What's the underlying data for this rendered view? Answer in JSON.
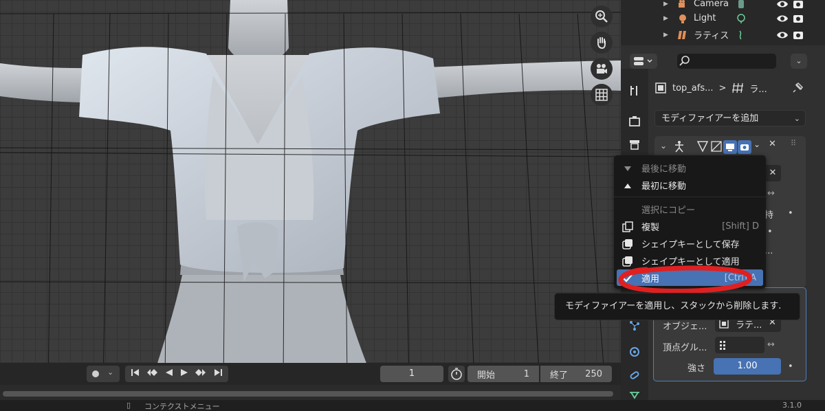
{
  "outliner": {
    "items": [
      {
        "name": "Camera",
        "icon": "camera-object-icon"
      },
      {
        "name": "Light",
        "icon": "light-object-icon"
      },
      {
        "name": "ラティス",
        "icon": "lattice-object-icon"
      }
    ]
  },
  "properties": {
    "search_placeholder": "",
    "breadcrumb": {
      "object": "top_afs...",
      "separator": ">",
      "data": "ラ..."
    },
    "add_modifier_label": "モディファイアーを追加",
    "modifier2": {
      "object_label": "オブジェ...",
      "object_value": "ラテ...",
      "vertex_group_label": "頂点グル...",
      "strength_label": "強さ",
      "strength_value": "1.00"
    },
    "partial_labels": {
      "keep": "持",
      "dot1": "•",
      "dot2": "•",
      "dot3": "..."
    }
  },
  "context_menu": {
    "items": [
      {
        "label": "最後に移動",
        "shortcut": "",
        "icon": "triangle-down-icon",
        "state": "disabled"
      },
      {
        "label": "最初に移動",
        "shortcut": "",
        "icon": "triangle-up-icon",
        "state": "normal"
      },
      {
        "label": "選択にコピー",
        "shortcut": "",
        "icon": "",
        "state": "disabled"
      },
      {
        "label": "複製",
        "shortcut": "[Shift] D",
        "icon": "duplicate-icon",
        "state": "normal"
      },
      {
        "label": "シェイプキーとして保存",
        "shortcut": "",
        "icon": "shapekey-icon",
        "state": "normal"
      },
      {
        "label": "シェイプキーとして適用",
        "shortcut": "",
        "icon": "shapekey-icon",
        "state": "normal"
      },
      {
        "label": "適用",
        "shortcut": "[Ctrl] A",
        "icon": "checkmark-icon",
        "state": "active"
      }
    ]
  },
  "tooltip": "モディファイアーを適用し、スタックから削除します.",
  "timeline": {
    "current_frame": "1",
    "start_label": "開始",
    "start_value": "1",
    "end_label": "終了",
    "end_value": "250"
  },
  "statusbar": {
    "context_menu": "コンテクストメニュー",
    "version": "3.1.0"
  },
  "colors": {
    "accent": "#4772b3",
    "annotation": "#e02020"
  }
}
